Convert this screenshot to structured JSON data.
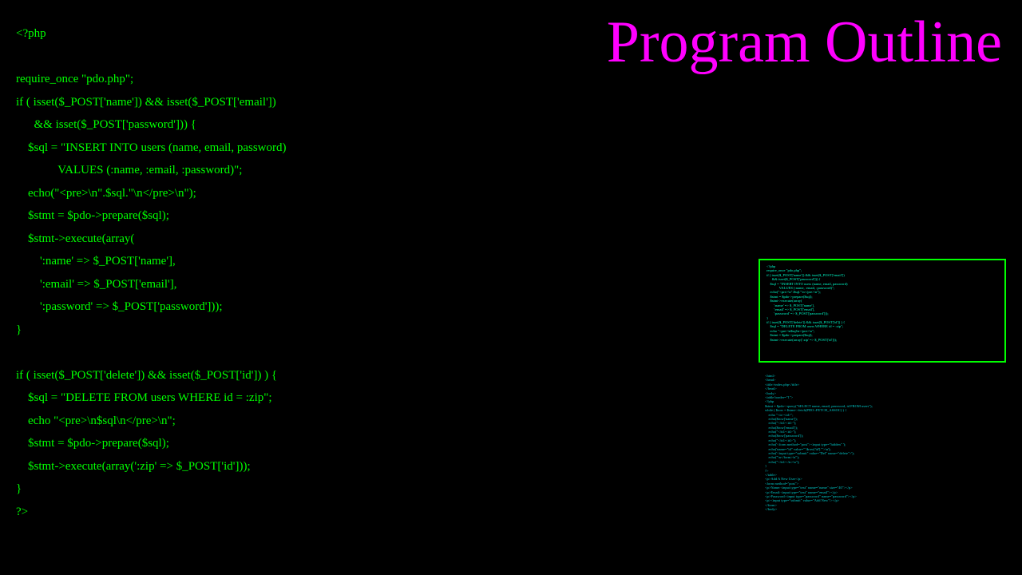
{
  "title": "Program\nOutline",
  "code": "<?php\n\nrequire_once \"pdo.php\";\nif ( isset($_POST['name']) && isset($_POST['email'])\n      && isset($_POST['password'])) {\n    $sql = \"INSERT INTO users (name, email, password)\n              VALUES (:name, :email, :password)\";\n    echo(\"<pre>\\n\".$sql.\"\\n</pre>\\n\");\n    $stmt = $pdo->prepare($sql);\n    $stmt->execute(array(\n        ':name' => $_POST['name'],\n        ':email' => $_POST['email'],\n        ':password' => $_POST['password']));\n}\n\nif ( isset($_POST['delete']) && isset($_POST['id']) ) {\n    $sql = \"DELETE FROM users WHERE id = :zip\";\n    echo \"<pre>\\n$sql\\n</pre>\\n\";\n    $stmt = $pdo->prepare($sql);\n    $stmt->execute(array(':zip' => $_POST['id']));\n}\n?>",
  "thumbnail_top": "<?php\nrequire_once \"pdo.php\";\nif ( isset($_POST['name']) && isset($_POST['email'])\n      && isset($_POST['password'])) {\n    $sql = \"INSERT INTO users (name, email, password)\n              VALUES (:name, :email, :password)\";\n    echo(\"<pre>\\n\".$sql.\"\\n</pre>\\n\");\n    $stmt = $pdo->prepare($sql);\n    $stmt->execute(array(\n        ':name' => $_POST['name'],\n        ':email' => $_POST['email'],\n        ':password' => $_POST['password']));\n}\nif ( isset($_POST['delete']) && isset($_POST['id']) ) {\n    $sql = \"DELETE FROM users WHERE id = :zip\";\n    echo \"<pre>\\n$sql\\n</pre>\\n\";\n    $stmt = $pdo->prepare($sql);\n    $stmt->execute(array(':zip' => $_POST['id']));",
  "thumbnail_bottom": "<html>\n<head>\n<title>index.php</title>\n</head>\n<body>\n<table border=\"1\">\n<?php\n$stmt = $pdo->query(\"SELECT name, email, password, id FROM users\");\nwhile ( $row = $stmt->fetch(PDO::FETCH_ASSOC) ) {\n    echo \"<tr><td>\";\n    echo($row['name']);\n    echo(\"</td><td>\");\n    echo($row['email']);\n    echo(\"</td><td>\");\n    echo($row['password']);\n    echo(\"</td><td>\");\n    echo('<form method=\"post\"><input type=\"hidden\" ');\n    echo('name=\"id\" value=\"'.$row['id'].'\">\\n');\n    echo('<input type=\"submit\" value=\"Del\" name=\"delete\">');\n    echo(\"\\n</form>\\n\");\n    echo(\"</td></tr>\\n\");\n}\n?>\n</table>\n<p>Add A New User</p>\n<form method=\"post\">\n<p>Name:<input type=\"text\" name=\"name\" size=\"40\"></p>\n<p>Email:<input type=\"text\" name=\"email\"></p>\n<p>Password:<input type=\"password\" name=\"password\"></p>\n<p><input type=\"submit\" value=\"Add New\"/></p>\n</form>\n</body>"
}
